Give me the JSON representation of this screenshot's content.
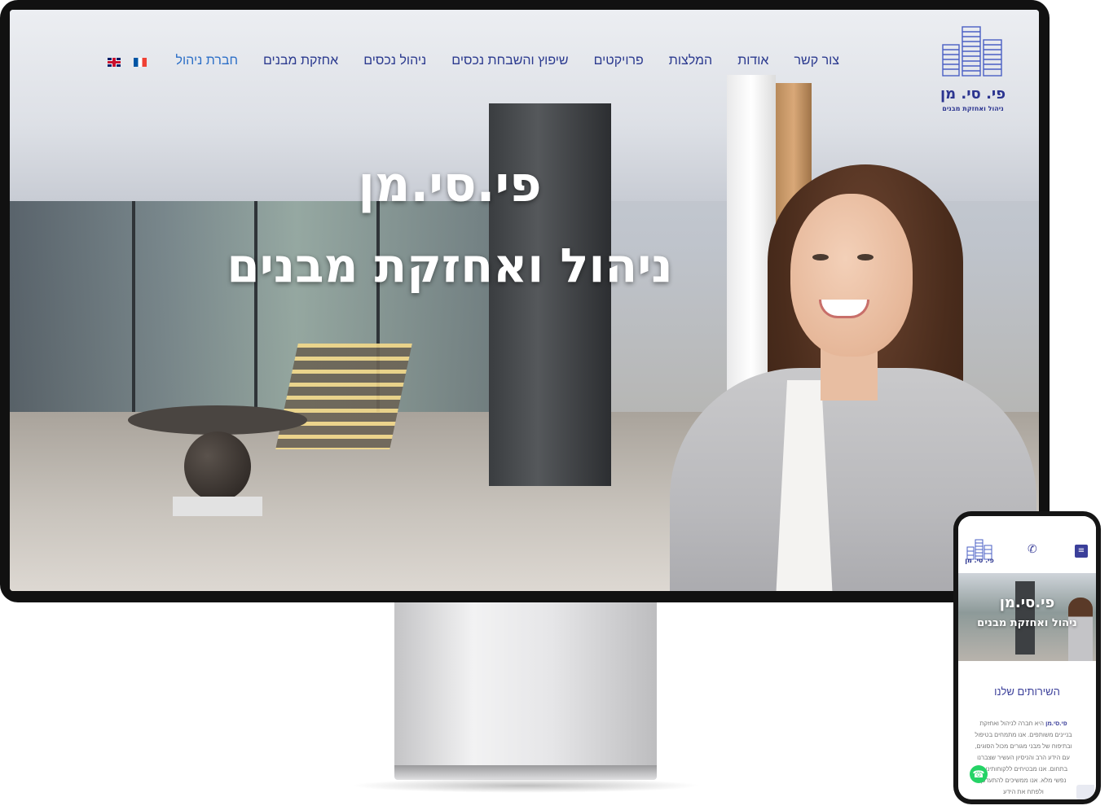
{
  "desktop": {
    "nav": {
      "items": [
        {
          "label": "חברת ניהול",
          "active": true
        },
        {
          "label": "אחזקת מבנים"
        },
        {
          "label": "ניהול נכסים"
        },
        {
          "label": "שיפוץ והשבחת נכסים"
        },
        {
          "label": "פרויקטים"
        },
        {
          "label": "המלצות"
        },
        {
          "label": "אודות"
        },
        {
          "label": "צור קשר"
        }
      ],
      "languages": [
        {
          "code": "en",
          "icon": "uk-flag-icon"
        },
        {
          "code": "fr",
          "icon": "france-flag-icon"
        }
      ]
    },
    "logo": {
      "name": "פי. סי. מן",
      "tagline": "ניהול ואחזקת מבנים"
    },
    "hero": {
      "title": "פי.סי.מן",
      "subtitle": "ניהול ואחזקת מבנים"
    }
  },
  "mobile": {
    "logo": {
      "name": "פי. סי. מן"
    },
    "menu_icon": "hamburger-icon",
    "phone_icon": "phone-icon",
    "hero": {
      "title": "פי.סי.מן",
      "subtitle": "ניהול ואחזקת מבנים"
    },
    "services_title": "השירותים שלנו",
    "body_brand": "פי.סי.מן",
    "body_lines": [
      "היא חברה לניהול ואחזקת",
      "בניינים משותפים. אנו מתמחים בטיפול",
      "ובתיפוח של מבני מגורים מכול הסוגים,",
      "עם הידע הרב והניסיון העשיר שצברנו",
      "בתחום. אנו מבטיחים ללקוחותינו ש",
      "נפשי מלא. אנו ממשיכים להתעדכן",
      "ולפתח את הידע"
    ],
    "whatsapp_icon": "whatsapp-icon",
    "accent": "#3b3f9a"
  },
  "colors": {
    "brand": "#2c3590",
    "nav_text": "#2b3a8f",
    "nav_active": "#2c6fc7"
  }
}
